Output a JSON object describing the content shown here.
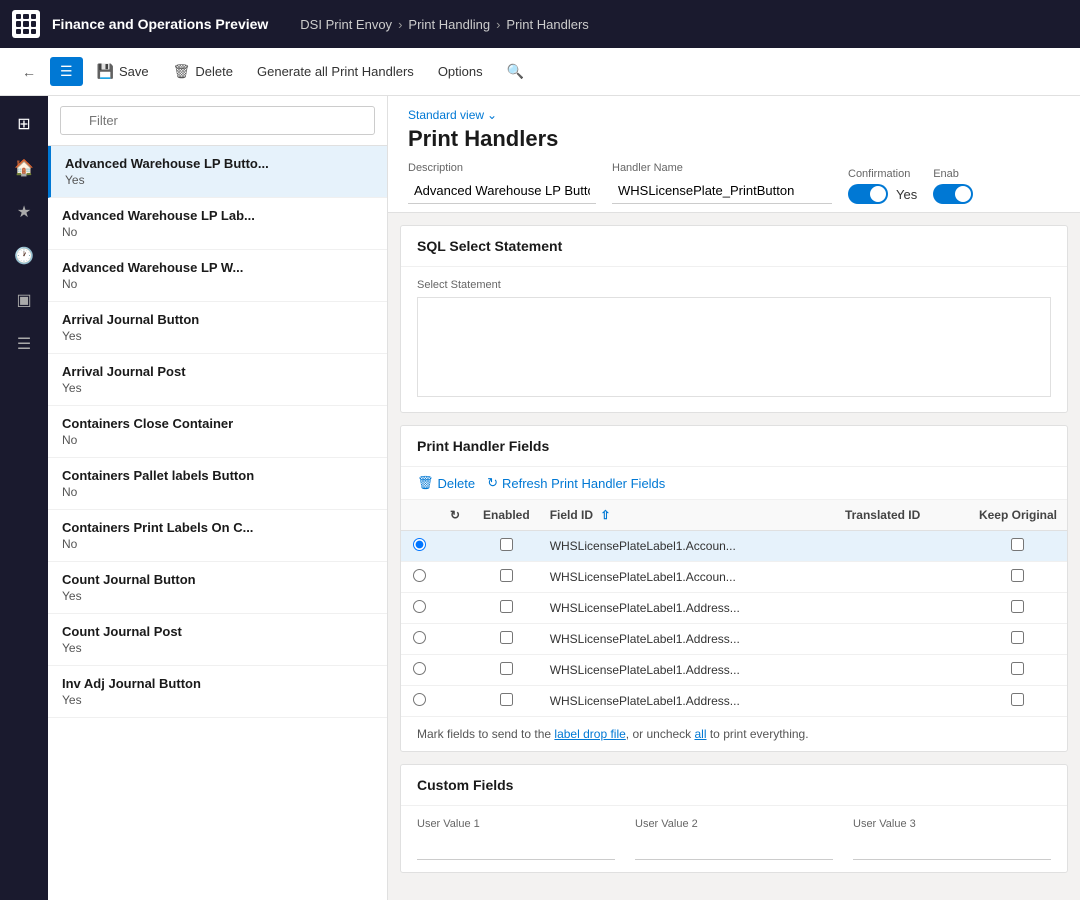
{
  "app": {
    "title": "Finance and Operations Preview",
    "app_icon_label": "app-grid"
  },
  "breadcrumb": {
    "items": [
      "DSI Print Envoy",
      "Print Handling",
      "Print Handlers"
    ]
  },
  "toolbar": {
    "back_label": "←",
    "menu_label": "☰",
    "save_label": "Save",
    "delete_label": "Delete",
    "generate_label": "Generate all Print Handlers",
    "options_label": "Options",
    "search_icon": "🔍"
  },
  "filter": {
    "placeholder": "Filter"
  },
  "list_items": [
    {
      "title": "Advanced Warehouse LP Butto...",
      "sub": "Yes",
      "active": true
    },
    {
      "title": "Advanced Warehouse LP Lab...",
      "sub": "No"
    },
    {
      "title": "Advanced Warehouse LP W...",
      "sub": "No"
    },
    {
      "title": "Arrival Journal Button",
      "sub": "Yes"
    },
    {
      "title": "Arrival Journal Post",
      "sub": "Yes"
    },
    {
      "title": "Containers Close Container",
      "sub": "No"
    },
    {
      "title": "Containers Pallet labels Button",
      "sub": "No"
    },
    {
      "title": "Containers Print Labels On C...",
      "sub": "No"
    },
    {
      "title": "Count Journal Button",
      "sub": "Yes"
    },
    {
      "title": "Count Journal Post",
      "sub": "Yes"
    },
    {
      "title": "Inv Adj Journal Button",
      "sub": "Yes"
    }
  ],
  "content": {
    "view_label": "Standard view",
    "page_title": "Print Handlers",
    "description_label": "Description",
    "description_value": "Advanced Warehouse LP Button",
    "handler_name_label": "Handler Name",
    "handler_name_value": "WHSLicensePlate_PrintButton",
    "confirmation_label": "Confirmation",
    "confirmation_toggle": true,
    "confirmation_value": "Yes",
    "enabled_label": "Enab"
  },
  "sql_section": {
    "title": "SQL Select Statement",
    "select_label": "Select Statement",
    "select_value": ""
  },
  "fields_section": {
    "title": "Print Handler Fields",
    "delete_label": "Delete",
    "refresh_label": "Refresh Print Handler Fields",
    "columns": [
      "Enabled",
      "Field ID",
      "Translated ID",
      "Keep Original"
    ],
    "rows": [
      {
        "enabled": false,
        "field_id": "WHSLicensePlateLabel1.Accoun...",
        "translated_id": "",
        "keep_original": false,
        "selected": true
      },
      {
        "enabled": false,
        "field_id": "WHSLicensePlateLabel1.Accoun...",
        "translated_id": "",
        "keep_original": false
      },
      {
        "enabled": false,
        "field_id": "WHSLicensePlateLabel1.Address...",
        "translated_id": "",
        "keep_original": false
      },
      {
        "enabled": false,
        "field_id": "WHSLicensePlateLabel1.Address...",
        "translated_id": "",
        "keep_original": false
      },
      {
        "enabled": false,
        "field_id": "WHSLicensePlateLabel1.Address...",
        "translated_id": "",
        "keep_original": false
      },
      {
        "enabled": false,
        "field_id": "WHSLicensePlateLabel1.Address...",
        "translated_id": "",
        "keep_original": false
      }
    ],
    "info_text": "Mark fields to send to the label drop file, or uncheck all to print everything."
  },
  "custom_fields": {
    "title": "Custom Fields",
    "fields": [
      {
        "label": "User Value 1",
        "value": ""
      },
      {
        "label": "User Value 2",
        "value": ""
      },
      {
        "label": "User Value 3",
        "value": ""
      }
    ]
  },
  "side_icons": [
    "⊞",
    "🏠",
    "☆",
    "🕐",
    "⊡",
    "☰"
  ]
}
